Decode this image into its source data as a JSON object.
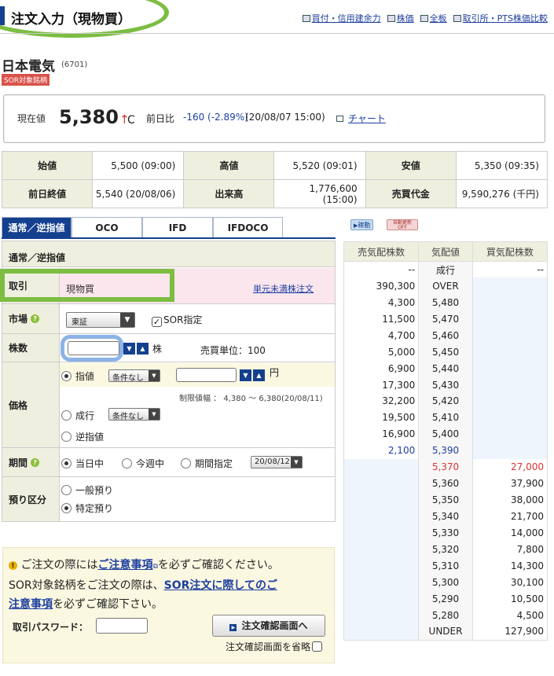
{
  "header": {
    "title": "注文入力（現物買）",
    "links": [
      "買付・信用建余力",
      "株価",
      "全板",
      "取引所・PTS株価比較"
    ]
  },
  "stock": {
    "name": "日本電気",
    "code": "(6701)",
    "sor_badge": "SOR対象銘柄"
  },
  "price": {
    "label": "現在値",
    "value": "5,380",
    "arrow": "↑",
    "flag": "C",
    "diff_label": "前日比",
    "diff": "-160 (-2.89%)",
    "time": "(20/08/07 15:00)",
    "chart_link": "チャート"
  },
  "summary": [
    [
      {
        "h": "始値"
      },
      {
        "v": "5,500 (09:00)"
      },
      {
        "h": "高値"
      },
      {
        "v": "5,520 (09:01)"
      },
      {
        "h": "安値"
      },
      {
        "v": "5,350 (09:35)"
      }
    ],
    [
      {
        "h": "前日終値"
      },
      {
        "v": "5,540 (20/08/06)"
      },
      {
        "h": "出来高"
      },
      {
        "v": "1,776,600 (15:00)"
      },
      {
        "h": "売買代金"
      },
      {
        "v": "9,590,276 (千円)"
      }
    ]
  ],
  "tabs": [
    "通常／逆指値",
    "OCO",
    "IFD",
    "IFDOCO"
  ],
  "form": {
    "section_title": "通常／逆指値",
    "torihiki_label": "取引",
    "torihiki_value": "現物買",
    "odd_lot_link": "単元未満株注文",
    "market_label": "市場",
    "market_value": "東証",
    "sor_label": "SOR指定",
    "sor_check": "✓",
    "qty_label": "株数",
    "qty_unit": "株",
    "unit_label": "売買単位：100",
    "price_label": "価格",
    "limit_label": "指値",
    "cond_none": "条件なし",
    "yen": "円",
    "limit_range": "制限値幅 ： 4,380 〜 6,380(20/08/11)",
    "market_order": "成行",
    "stop_order": "逆指値",
    "period_label": "期間",
    "today": "当日中",
    "this_week": "今週中",
    "period_specify": "期間指定",
    "period_date": "20/08/12",
    "deposit_label": "預り区分",
    "general": "一般預り",
    "specific": "特定預り"
  },
  "notice": {
    "line1a": "ご注文の際には",
    "line1_link": "ご注意事項",
    "line1b": "を必ずご確認ください。",
    "line2a": "SOR対象銘柄をご注文の際は、",
    "line2_link1": "SOR注文に際してのご",
    "line3_link": "注意事項",
    "line3b": "を必ずご確認下さい。",
    "password_label": "取引パスワード：",
    "confirm_button": "注文確認画面へ",
    "skip_label": "注文確認画面を省略"
  },
  "board_buttons": {
    "refresh": "稼動",
    "auto": "自動更新 OFF"
  },
  "board": {
    "headers": [
      "売気配株数",
      "気配値",
      "買気配株数"
    ],
    "rows": [
      [
        "--",
        "成行",
        "--"
      ],
      [
        "390,300",
        "OVER",
        ""
      ],
      [
        "4,300",
        "5,480",
        ""
      ],
      [
        "11,500",
        "5,470",
        ""
      ],
      [
        "4,700",
        "5,460",
        ""
      ],
      [
        "5,000",
        "5,450",
        ""
      ],
      [
        "6,900",
        "5,440",
        ""
      ],
      [
        "17,300",
        "5,430",
        ""
      ],
      [
        "32,200",
        "5,420",
        ""
      ],
      [
        "19,500",
        "5,410",
        ""
      ],
      [
        "16,900",
        "5,400",
        ""
      ],
      [
        "2,100",
        "5,390",
        ""
      ],
      [
        "",
        "5,370",
        "27,000"
      ],
      [
        "",
        "5,360",
        "37,900"
      ],
      [
        "",
        "5,350",
        "38,000"
      ],
      [
        "",
        "5,340",
        "21,700"
      ],
      [
        "",
        "5,330",
        "14,000"
      ],
      [
        "",
        "5,320",
        "7,800"
      ],
      [
        "",
        "5,310",
        "14,300"
      ],
      [
        "",
        "5,300",
        "30,100"
      ],
      [
        "",
        "5,290",
        "10,500"
      ],
      [
        "",
        "5,280",
        "4,500"
      ],
      [
        "",
        "UNDER",
        "127,900"
      ]
    ]
  },
  "colors": {
    "navy": "#14408f",
    "green_annotation": "#7cbd42",
    "red": "#d33",
    "blue": "#1d3fa0"
  }
}
